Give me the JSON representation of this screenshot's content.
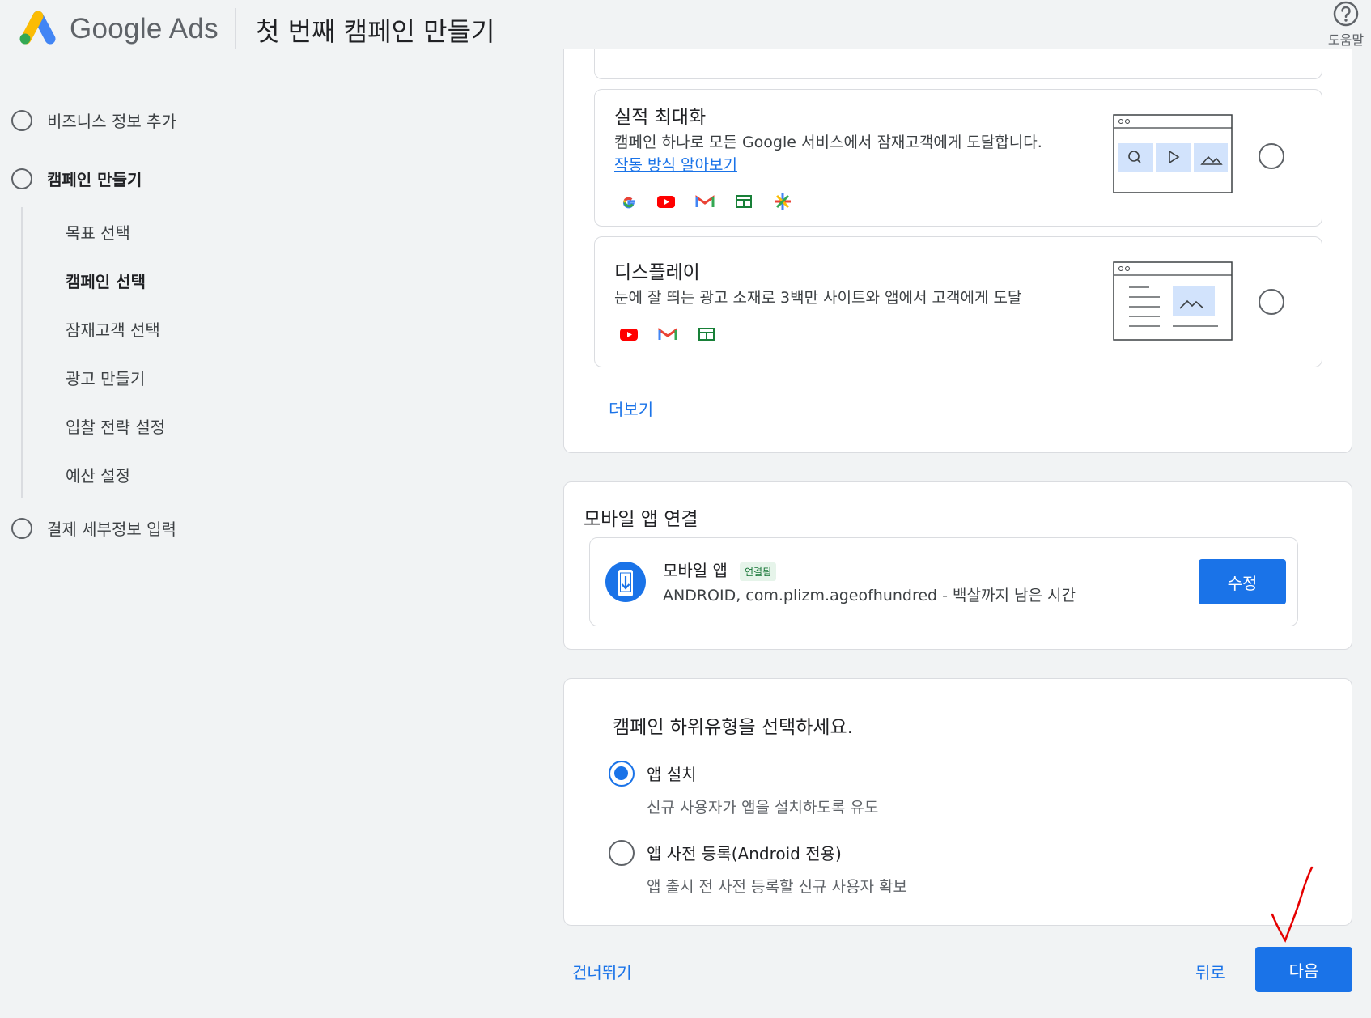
{
  "header": {
    "brand": "Google Ads",
    "title": "첫 번째 캠페인 만들기",
    "help_label": "도움말"
  },
  "stepper": {
    "steps": [
      {
        "label": "비즈니스 정보 추가"
      },
      {
        "label": "캠페인 만들기"
      },
      {
        "label": "결제 세부정보 입력"
      }
    ],
    "substeps": [
      {
        "label": "목표 선택"
      },
      {
        "label": "캠페인 선택"
      },
      {
        "label": "잠재고객 선택"
      },
      {
        "label": "광고 만들기"
      },
      {
        "label": "입찰 전략 설정"
      },
      {
        "label": "예산 설정"
      }
    ]
  },
  "campaign_types": {
    "options": [
      {
        "title": "실적 최대화",
        "description": "캠페인 하나로 모든 Google 서비스에서 잠재고객에게 도달합니다.",
        "link": "작동 방식 알아보기",
        "services": [
          "google-icon",
          "youtube-icon",
          "gmail-icon",
          "display-icon",
          "discover-icon"
        ],
        "selected": false
      },
      {
        "title": "디스플레이",
        "description": "눈에 잘 띄는 광고 소재로 3백만 사이트와 앱에서 고객에게 도달",
        "services": [
          "youtube-icon",
          "gmail-icon",
          "display-icon"
        ],
        "selected": false
      }
    ],
    "more_label": "더보기"
  },
  "mobile_app": {
    "section_title": "모바일 앱 연결",
    "app_label": "모바일 앱",
    "badge": "연결됨",
    "app_detail": "ANDROID, com.plizm.ageofhundred - 백살까지 남은 시간",
    "edit_label": "수정"
  },
  "subtype": {
    "question": "캠페인 하위유형을 선택하세요.",
    "options": [
      {
        "label": "앱 설치",
        "description": "신규 사용자가 앱을 설치하도록 유도",
        "selected": true
      },
      {
        "label": "앱 사전 등록(Android 전용)",
        "description": "앱 출시 전 사전 등록할 신규 사용자 확보",
        "selected": false
      }
    ]
  },
  "footer": {
    "skip_label": "건너뛰기",
    "back_label": "뒤로",
    "next_label": "다음"
  },
  "colors": {
    "accent": "#1a73e8",
    "annotation": "#e50000"
  }
}
